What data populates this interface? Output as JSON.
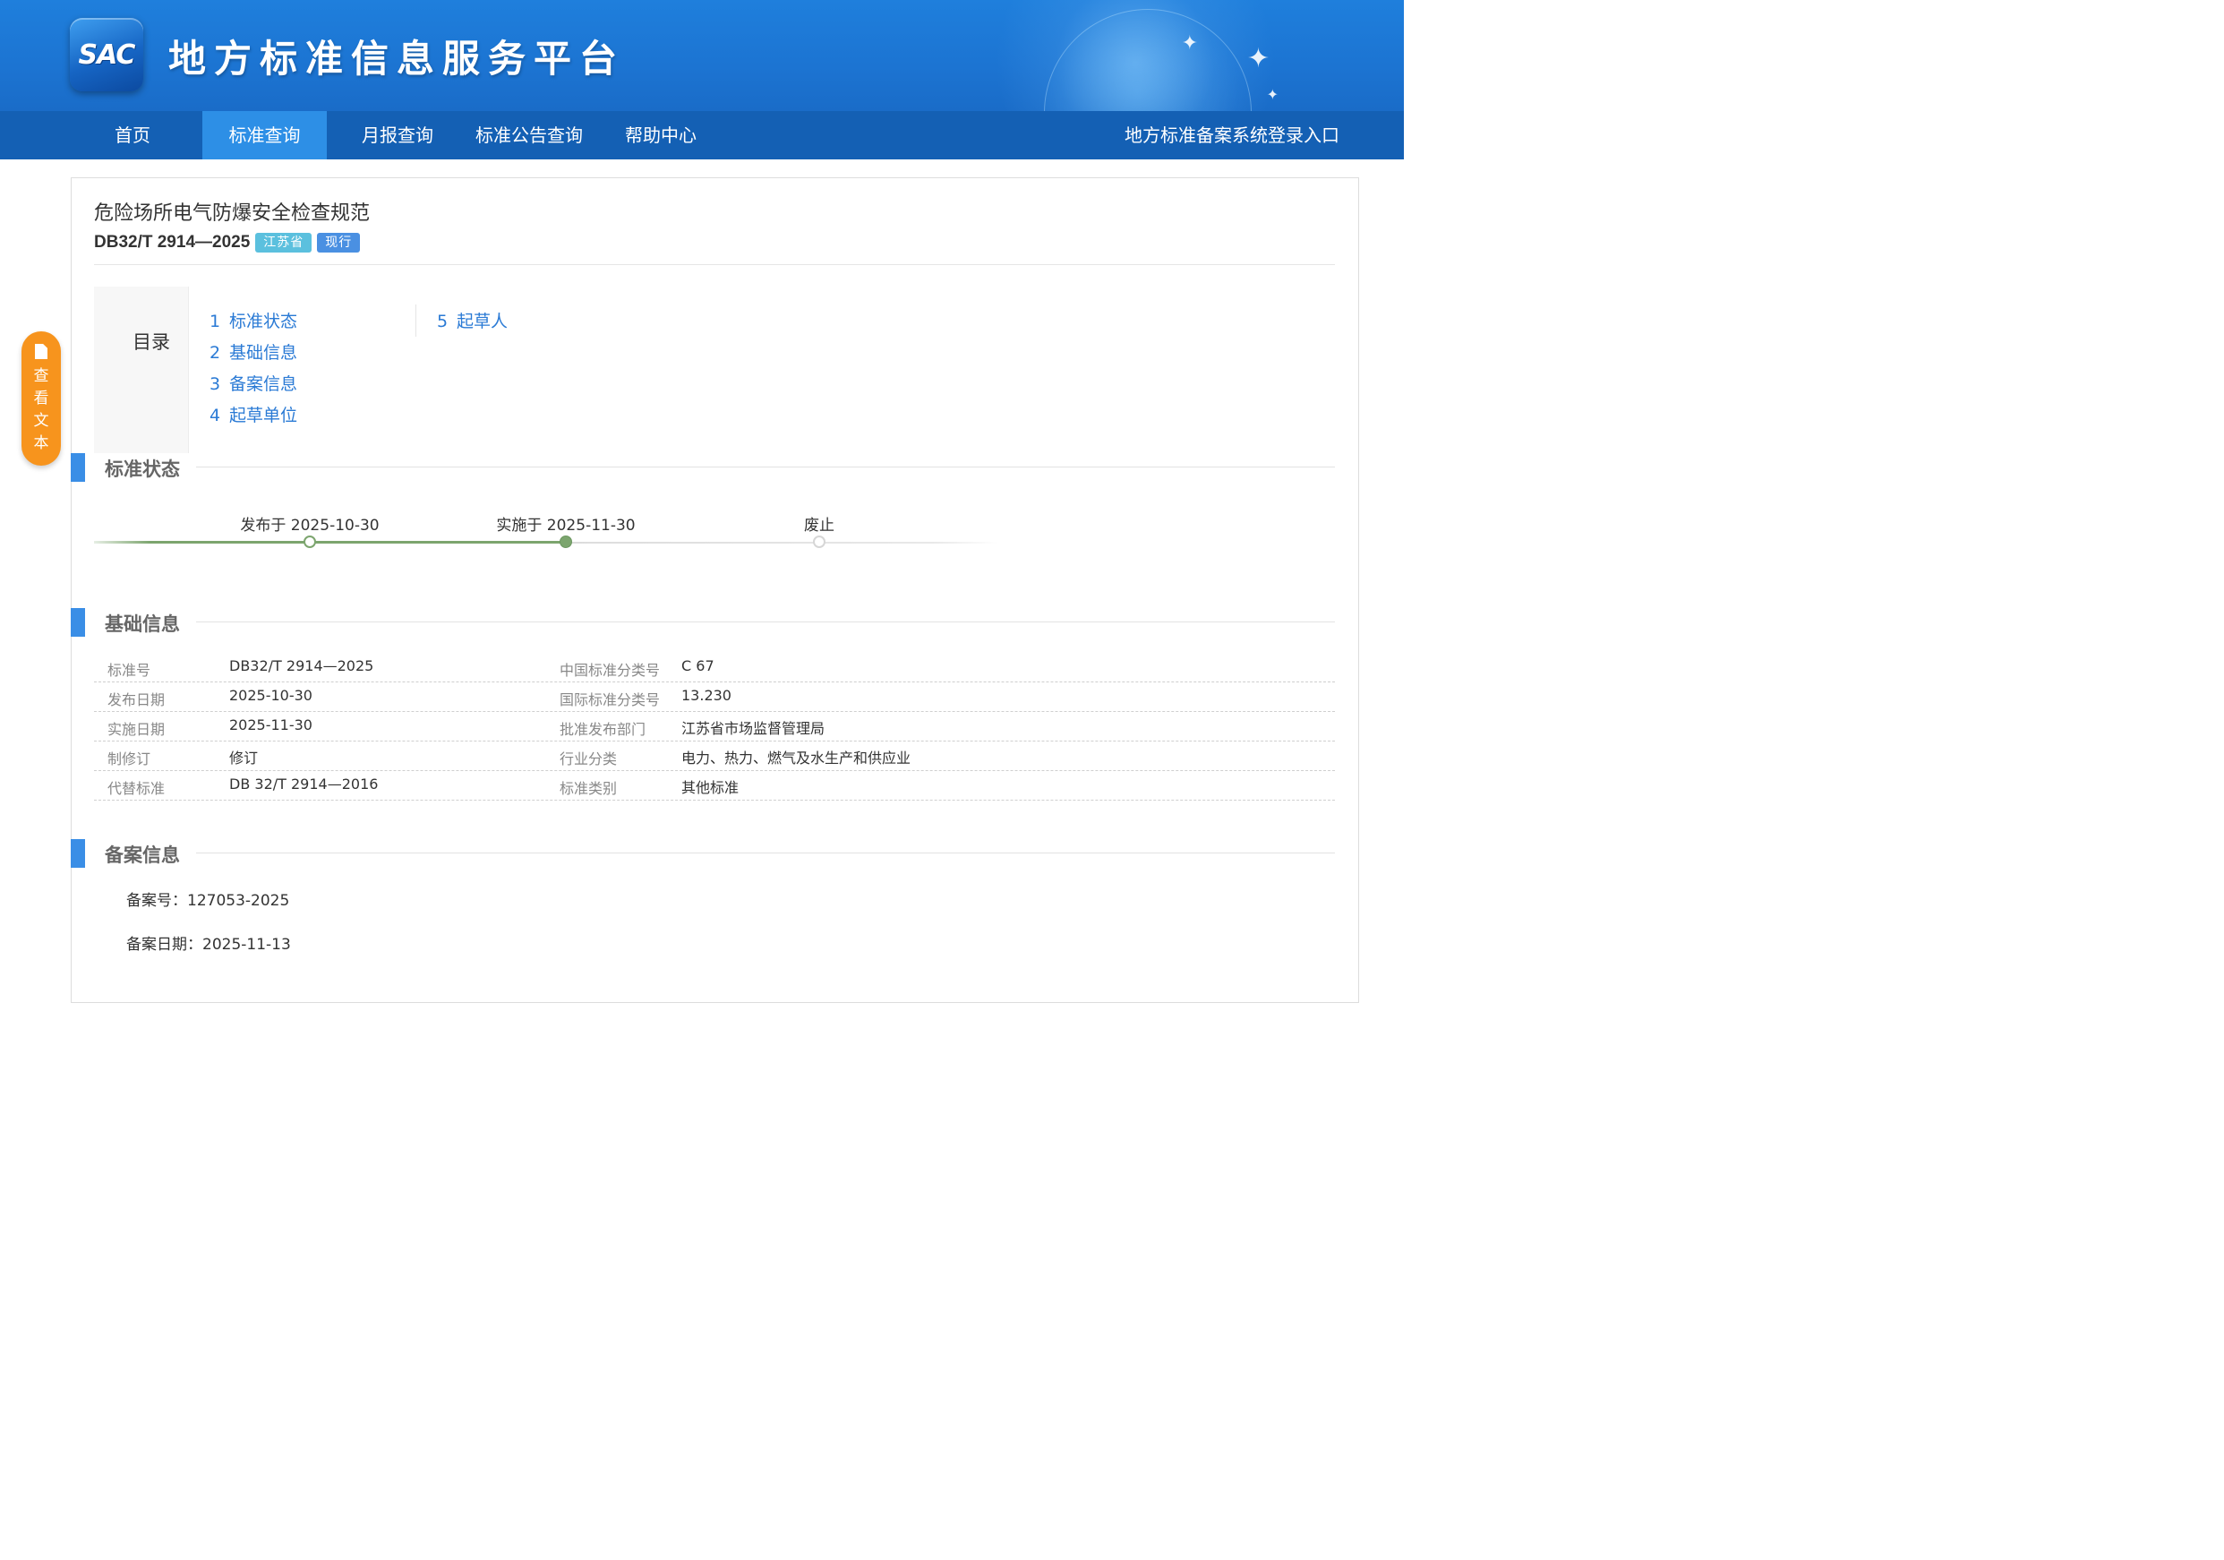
{
  "header": {
    "logo_text": "SAC",
    "site_title": "地方标准信息服务平台"
  },
  "nav": {
    "items": [
      {
        "label": "首页",
        "active": false
      },
      {
        "label": "标准查询",
        "active": true
      },
      {
        "label": "月报查询",
        "active": false
      },
      {
        "label": "标准公告查询",
        "active": false
      },
      {
        "label": "帮助中心",
        "active": false
      }
    ],
    "login_label": "地方标准备案系统登录入口"
  },
  "document": {
    "title": "危险场所电气防爆安全检查规范",
    "code": "DB32/T 2914—2025",
    "province_badge": "江苏省",
    "status_badge": "现行"
  },
  "toc": {
    "label": "目录",
    "items": [
      {
        "num": "1",
        "label": "标准状态"
      },
      {
        "num": "2",
        "label": "基础信息"
      },
      {
        "num": "3",
        "label": "备案信息"
      },
      {
        "num": "4",
        "label": "起草单位"
      },
      {
        "num": "5",
        "label": "起草人"
      }
    ]
  },
  "float_button": {
    "label": "查看文本",
    "chars": [
      "查",
      "看",
      "文",
      "本"
    ],
    "icon": "document-icon"
  },
  "sections": {
    "status": "标准状态",
    "basic": "基础信息",
    "record": "备案信息"
  },
  "timeline": [
    {
      "label": "发布于 2025-10-30",
      "state": "done"
    },
    {
      "label": "实施于 2025-11-30",
      "state": "current"
    },
    {
      "label": "废止",
      "state": "future"
    }
  ],
  "basic_info": [
    {
      "k1": "标准号",
      "v1": "DB32/T 2914—2025",
      "k2": "中国标准分类号",
      "v2": "C 67"
    },
    {
      "k1": "发布日期",
      "v1": "2025-10-30",
      "k2": "国际标准分类号",
      "v2": "13.230"
    },
    {
      "k1": "实施日期",
      "v1": "2025-11-30",
      "k2": "批准发布部门",
      "v2": "江苏省市场监督管理局"
    },
    {
      "k1": "制修订",
      "v1": "修订",
      "k2": "行业分类",
      "v2": "电力、热力、燃气及水生产和供应业"
    },
    {
      "k1": "代替标准",
      "v1": "DB 32/T 2914—2016",
      "k2": "标准类别",
      "v2": "其他标准"
    }
  ],
  "record_info": {
    "number": "备案号：127053-2025",
    "date": "备案日期：2025-11-13"
  },
  "colors": {
    "banner": "#1c74d2",
    "nav": "#1460b4",
    "nav_active": "#2d8fe6",
    "accent": "#3a8ee6",
    "link": "#2a7ad5",
    "float_button": "#f7941d",
    "timeline": "#7ca56e"
  }
}
